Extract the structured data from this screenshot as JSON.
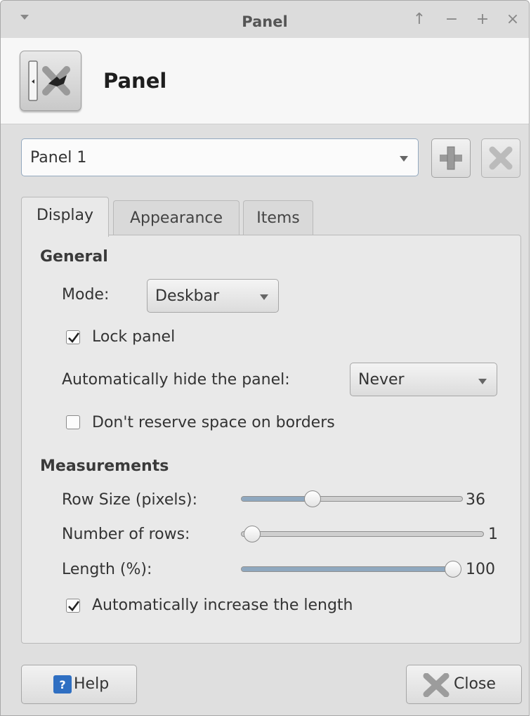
{
  "window": {
    "title": "Panel"
  },
  "titlebar_buttons": [
    {
      "name": "maximize-up-button",
      "glyph": "↑"
    },
    {
      "name": "minimize-button",
      "glyph": "−"
    },
    {
      "name": "expand-button",
      "glyph": "+"
    },
    {
      "name": "close-window-button",
      "glyph": "×"
    }
  ],
  "header": {
    "title": "Panel",
    "icon": "panel-preferences-icon"
  },
  "panel_selector": {
    "selected": "Panel 1",
    "add_icon": "plus-icon",
    "remove_icon": "remove-icon"
  },
  "tabs": [
    {
      "label": "Display",
      "active": true
    },
    {
      "label": "Appearance",
      "active": false
    },
    {
      "label": "Items",
      "active": false
    }
  ],
  "general": {
    "heading": "General",
    "mode_label": "Mode:",
    "mode_value": "Deskbar",
    "lock_panel_label": "Lock panel",
    "lock_panel_checked": true,
    "autohide_label": "Automatically hide the panel:",
    "autohide_value": "Never",
    "reserve_label": "Don't reserve space on borders",
    "reserve_checked": false
  },
  "measurements": {
    "heading": "Measurements",
    "row_size_label": "Row Size (pixels):",
    "row_size_value": "36",
    "row_size_fraction": 0.2,
    "rows_label": "Number of rows:",
    "rows_value": "1",
    "rows_fraction": 0.0,
    "length_label": "Length (%):",
    "length_value": "100",
    "length_fraction": 1.0,
    "auto_length_label": "Automatically increase the length",
    "auto_length_checked": true
  },
  "footer": {
    "help_label": "Help",
    "help_icon": "help-icon",
    "close_label": "Close",
    "close_icon": "close-icon"
  },
  "colors": {
    "accent": "#8fa8bf",
    "help_blue": "#2f6fc2"
  }
}
